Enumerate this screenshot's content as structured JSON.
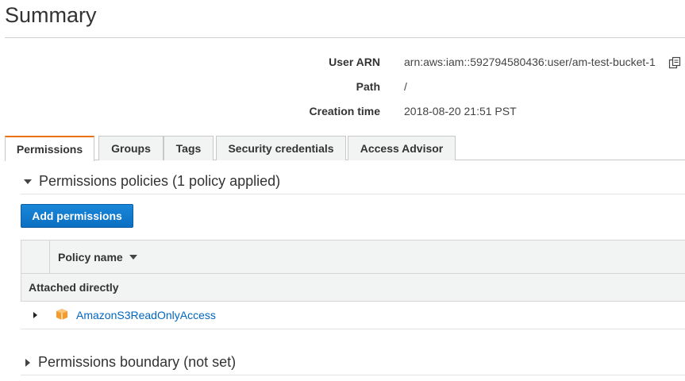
{
  "page": {
    "title": "Summary"
  },
  "summary": {
    "rows": [
      {
        "label": "User ARN",
        "value": "arn:aws:iam::592794580436:user/am-test-bucket-1"
      },
      {
        "label": "Path",
        "value": "/"
      },
      {
        "label": "Creation time",
        "value": "2018-08-20 21:51 PST"
      }
    ],
    "copy_icon": "copy-icon"
  },
  "tabs": [
    {
      "label": "Permissions",
      "active": true
    },
    {
      "label": "Groups",
      "active": false
    },
    {
      "label": "Tags",
      "active": false
    },
    {
      "label": "Security credentials",
      "active": false
    },
    {
      "label": "Access Advisor",
      "active": false
    }
  ],
  "permissions": {
    "policies_header": "Permissions policies (1 policy applied)",
    "add_button": "Add permissions",
    "table": {
      "column_policy_name": "Policy name",
      "group_label": "Attached directly",
      "rows": [
        {
          "name": "AmazonS3ReadOnlyAccess",
          "icon": "aws-managed-policy-icon"
        }
      ]
    },
    "boundary_header": "Permissions boundary (not set)"
  },
  "colors": {
    "active_tab_accent": "#ec7211",
    "primary_button": "#0a6fc2",
    "link": "#0066c0",
    "policy_icon": "#f59b2a"
  }
}
